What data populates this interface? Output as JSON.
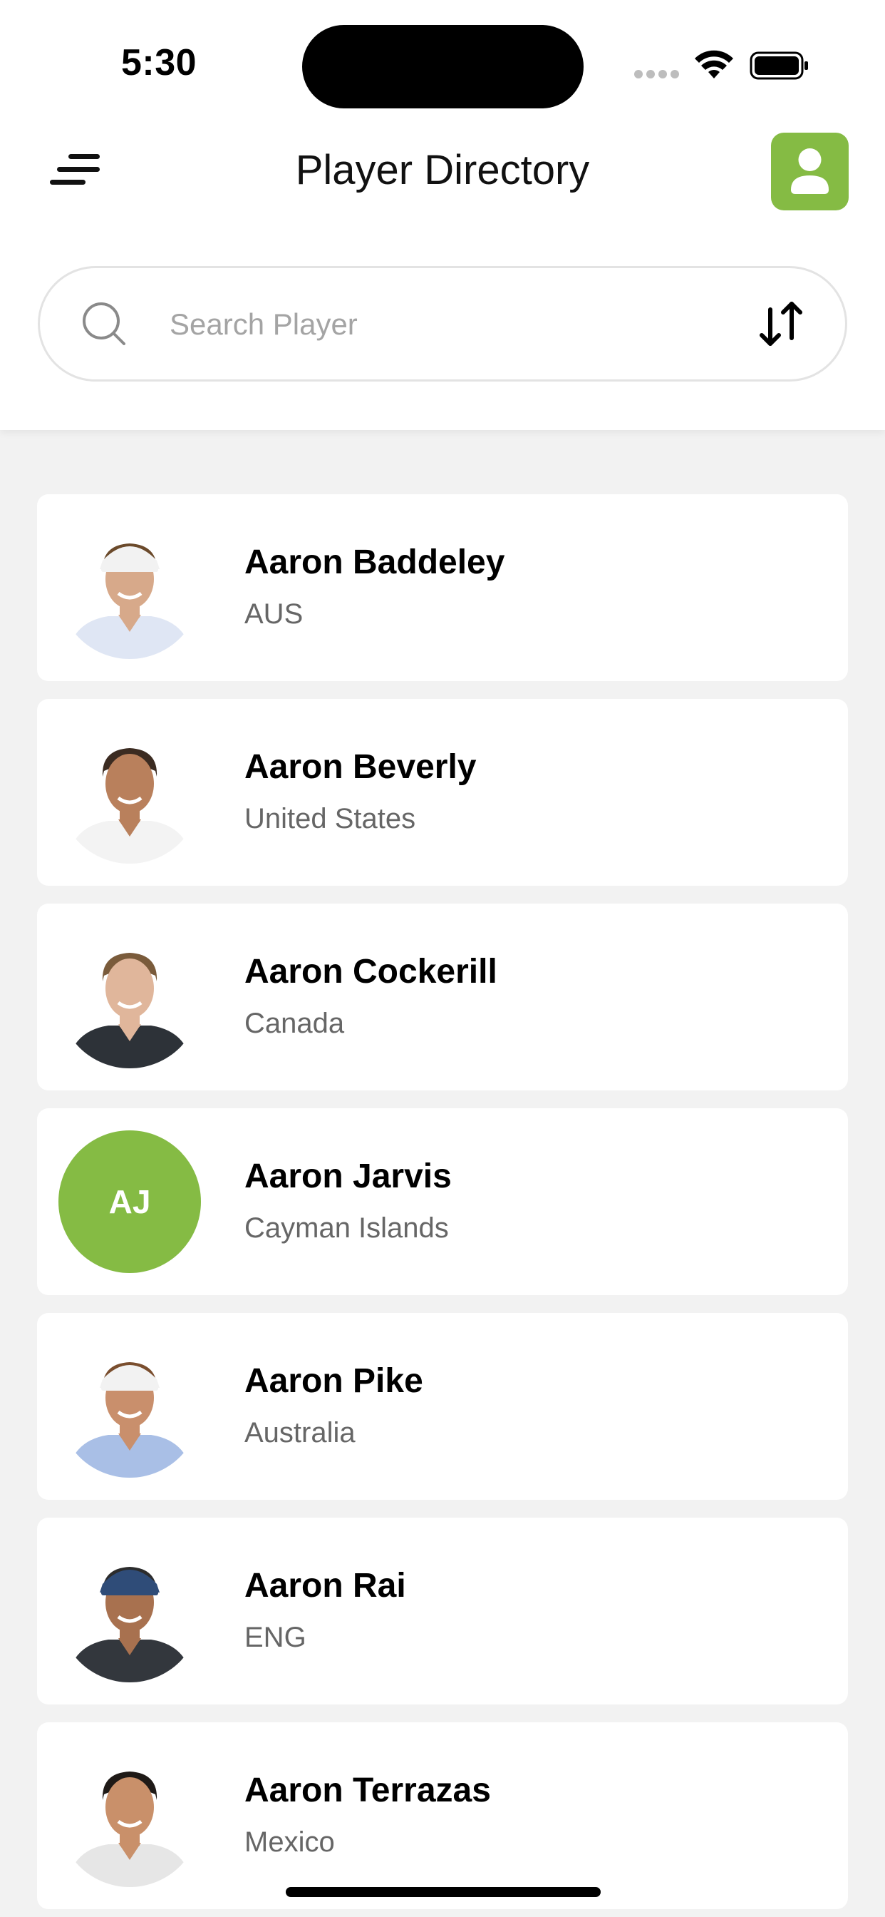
{
  "status_bar": {
    "time": "5:30"
  },
  "header": {
    "title": "Player Directory",
    "menu_icon": "menu-icon",
    "profile_icon": "user-icon"
  },
  "search": {
    "placeholder": "Search Player",
    "value": "",
    "sort_icon": "sort-arrows-icon"
  },
  "colors": {
    "accent": "#85BB44",
    "background": "#F2F2F2",
    "card": "#FFFFFF",
    "secondary_text": "#666666"
  },
  "players": [
    {
      "name": "Aaron Baddeley",
      "country": "AUS",
      "avatar": "photo",
      "skin": "#d7a98a",
      "hair": "#6b4a2b",
      "cap": "#f2f2f2",
      "shirt": "#dfe6f4"
    },
    {
      "name": "Aaron Beverly",
      "country": "United States",
      "avatar": "photo",
      "skin": "#b9805c",
      "hair": "#3b2b21",
      "cap": "",
      "shirt": "#f3f3f3"
    },
    {
      "name": "Aaron Cockerill",
      "country": "Canada",
      "avatar": "photo",
      "skin": "#e0b69b",
      "hair": "#7a5b3b",
      "cap": "",
      "shirt": "#2d3238"
    },
    {
      "name": "Aaron Jarvis",
      "country": "Cayman Islands",
      "avatar": "initials",
      "initials": "AJ"
    },
    {
      "name": "Aaron Pike",
      "country": "Australia",
      "avatar": "photo",
      "skin": "#c98f6c",
      "hair": "#7a4e2e",
      "cap": "#f2f2f2",
      "shirt": "#a9bfe6"
    },
    {
      "name": "Aaron Rai",
      "country": "ENG",
      "avatar": "photo",
      "skin": "#a8714f",
      "hair": "#2c2c2c",
      "cap": "#2f4c78",
      "shirt": "#33373d"
    },
    {
      "name": "Aaron Terrazas",
      "country": "Mexico",
      "avatar": "photo",
      "skin": "#c9906a",
      "hair": "#1f1a17",
      "cap": "",
      "shirt": "#e6e6e6"
    }
  ]
}
